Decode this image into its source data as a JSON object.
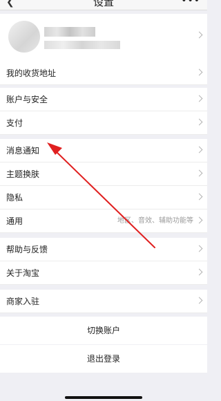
{
  "header": {
    "title": "设置",
    "back_icon": "chevron-left-icon",
    "more_icon": "more-icon"
  },
  "profile": {
    "name": "",
    "subtitle": ""
  },
  "groups": [
    {
      "items": [
        {
          "label": "我的收货地址"
        }
      ]
    },
    {
      "items": [
        {
          "label": "账户与安全"
        },
        {
          "label": "支付"
        }
      ]
    },
    {
      "items": [
        {
          "label": "消息通知"
        },
        {
          "label": "主题换肤"
        },
        {
          "label": "隐私"
        },
        {
          "label": "通用",
          "detail": "地区、音效、辅助功能等"
        }
      ]
    },
    {
      "items": [
        {
          "label": "帮助与反馈"
        },
        {
          "label": "关于淘宝"
        }
      ]
    },
    {
      "items": [
        {
          "label": "商家入驻"
        }
      ]
    }
  ],
  "actions": {
    "switch_account": "切换账户",
    "logout": "退出登录"
  },
  "annotation": {
    "color": "#e02020"
  }
}
